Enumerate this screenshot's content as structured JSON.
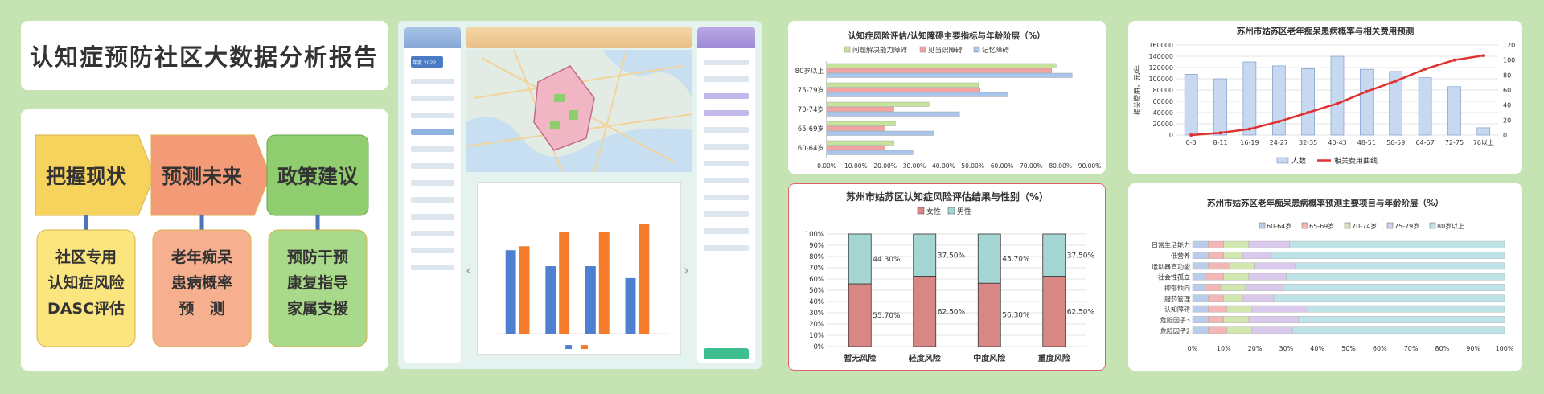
{
  "report_title": "认知症预防社区大数据分析报告",
  "flow": {
    "steps": [
      "把握现状",
      "预测未来",
      "政策建议"
    ],
    "details": [
      [
        "社区专用",
        "认知症风险",
        "DASC评估"
      ],
      [
        "老年痴呆",
        "患病概率",
        "预　测"
      ],
      [
        "预防干预",
        "康复指导",
        "家属支援"
      ]
    ],
    "colors": {
      "step1": "#f6d35c",
      "step2": "#f39a76",
      "step3": "#8fcd6f",
      "detail1": "#fbe57f",
      "detail2": "#f7b08f",
      "detail3": "#a9d98a"
    }
  },
  "dashboard": {
    "selector_label": "年度 2022"
  },
  "chart_data": [
    {
      "id": "c1",
      "type": "bar",
      "orientation": "horizontal",
      "title": "认知症风险评估/认知障碍主要指标与年龄阶层（%）",
      "categories": [
        "80岁以上",
        "75-79岁",
        "70-74岁",
        "65-69岁",
        "60-64岁"
      ],
      "series": [
        {
          "name": "问题解决能力障碍",
          "color": "#c5e39a",
          "values": [
            78.5,
            52.0,
            35.0,
            23.5,
            23.0
          ]
        },
        {
          "name": "见当识障碍",
          "color": "#f4a3a3",
          "values": [
            77.0,
            52.5,
            23.0,
            20.0,
            20.0
          ]
        },
        {
          "name": "记忆障碍",
          "color": "#a9c6ea",
          "values": [
            84.0,
            62.0,
            45.5,
            36.5,
            29.5
          ]
        }
      ],
      "xlim": [
        0,
        90
      ],
      "xticks": [
        "0.00%",
        "10.00%",
        "20.00%",
        "30.00%",
        "40.00%",
        "50.00%",
        "60.00%",
        "70.00%",
        "80.00%",
        "90.00%"
      ]
    },
    {
      "id": "c2",
      "type": "bar",
      "stacked": true,
      "title": "苏州市姑苏区认知症风险评估结果与性别（%）",
      "categories": [
        "暂无风险",
        "轻度风险",
        "中度风险",
        "重度风险"
      ],
      "series": [
        {
          "name": "女性",
          "color": "#d98784",
          "values": [
            55.7,
            62.5,
            56.3,
            62.5
          ]
        },
        {
          "name": "男性",
          "color": "#a6d6d3",
          "values": [
            44.3,
            37.5,
            43.7,
            37.5
          ]
        }
      ],
      "labels_female": [
        "55.70%",
        "62.50%",
        "56.30%",
        "62.50%"
      ],
      "labels_male": [
        "44.30%",
        "37.50%",
        "43.70%",
        "37.50%"
      ],
      "yticks": [
        "0%",
        "10%",
        "20%",
        "30%",
        "40%",
        "50%",
        "60%",
        "70%",
        "80%",
        "90%",
        "100%"
      ]
    },
    {
      "id": "c3",
      "type": "bar+line",
      "title": "苏州市姑苏区老年痴呆患病概率与相关费用预测",
      "ylabel": "相关费用，元/年",
      "categories": [
        "0-3",
        "8-11",
        "16-19",
        "24-27",
        "32-35",
        "40-43",
        "48-51",
        "56-59",
        "64-67",
        "72-75",
        "76以上"
      ],
      "bars": {
        "name": "人数",
        "color": "#c7d9f1",
        "values": [
          108000,
          100000,
          130000,
          123000,
          118000,
          140000,
          117000,
          113000,
          102000,
          86000,
          13000
        ]
      },
      "line": {
        "name": "相关费用曲线",
        "color": "#e03030",
        "values": [
          0,
          3,
          8,
          18,
          30,
          42,
          58,
          72,
          88,
          100,
          106
        ]
      },
      "y_left": {
        "min": 0,
        "max": 160000,
        "ticks": [
          "0",
          "20000",
          "40000",
          "60000",
          "80000",
          "100000",
          "120000",
          "140000",
          "160000"
        ]
      },
      "y_right": {
        "min": 0,
        "max": 120,
        "ticks": [
          "0",
          "20",
          "40",
          "60",
          "80",
          "100",
          "120"
        ]
      }
    },
    {
      "id": "c4",
      "type": "bar",
      "orientation": "horizontal",
      "stacked": true,
      "title": "苏州市姑苏区老年痴呆患病概率预测主要项目与年龄阶层（%）",
      "categories": [
        "日常生活能力",
        "低营养",
        "运动器官功能",
        "社会性孤立",
        "抑郁倾向",
        "服药管理",
        "认知障碍",
        "危险因子3",
        "危险因子2"
      ],
      "series": [
        {
          "name": "60-64岁",
          "color": "#b9cdeb",
          "values": [
            5,
            5,
            5,
            4,
            4,
            5,
            5,
            5,
            5
          ]
        },
        {
          "name": "65-69岁",
          "color": "#f2b6b6",
          "values": [
            5,
            5,
            7,
            6,
            5,
            5,
            6,
            5,
            6
          ]
        },
        {
          "name": "70-74岁",
          "color": "#d2e7b0",
          "values": [
            8,
            6,
            8,
            8,
            8,
            6,
            8,
            8,
            8
          ]
        },
        {
          "name": "75-79岁",
          "color": "#d9c9ec",
          "values": [
            13,
            9,
            13,
            12,
            12,
            10,
            18,
            16,
            13
          ]
        },
        {
          "name": "80岁以上",
          "color": "#bfe2e6",
          "values": [
            69,
            75,
            67,
            70,
            71,
            74,
            63,
            66,
            68
          ]
        }
      ],
      "xticks": [
        "0%",
        "10%",
        "20%",
        "30%",
        "40%",
        "50%",
        "60%",
        "70%",
        "80%",
        "90%",
        "100%"
      ]
    }
  ]
}
